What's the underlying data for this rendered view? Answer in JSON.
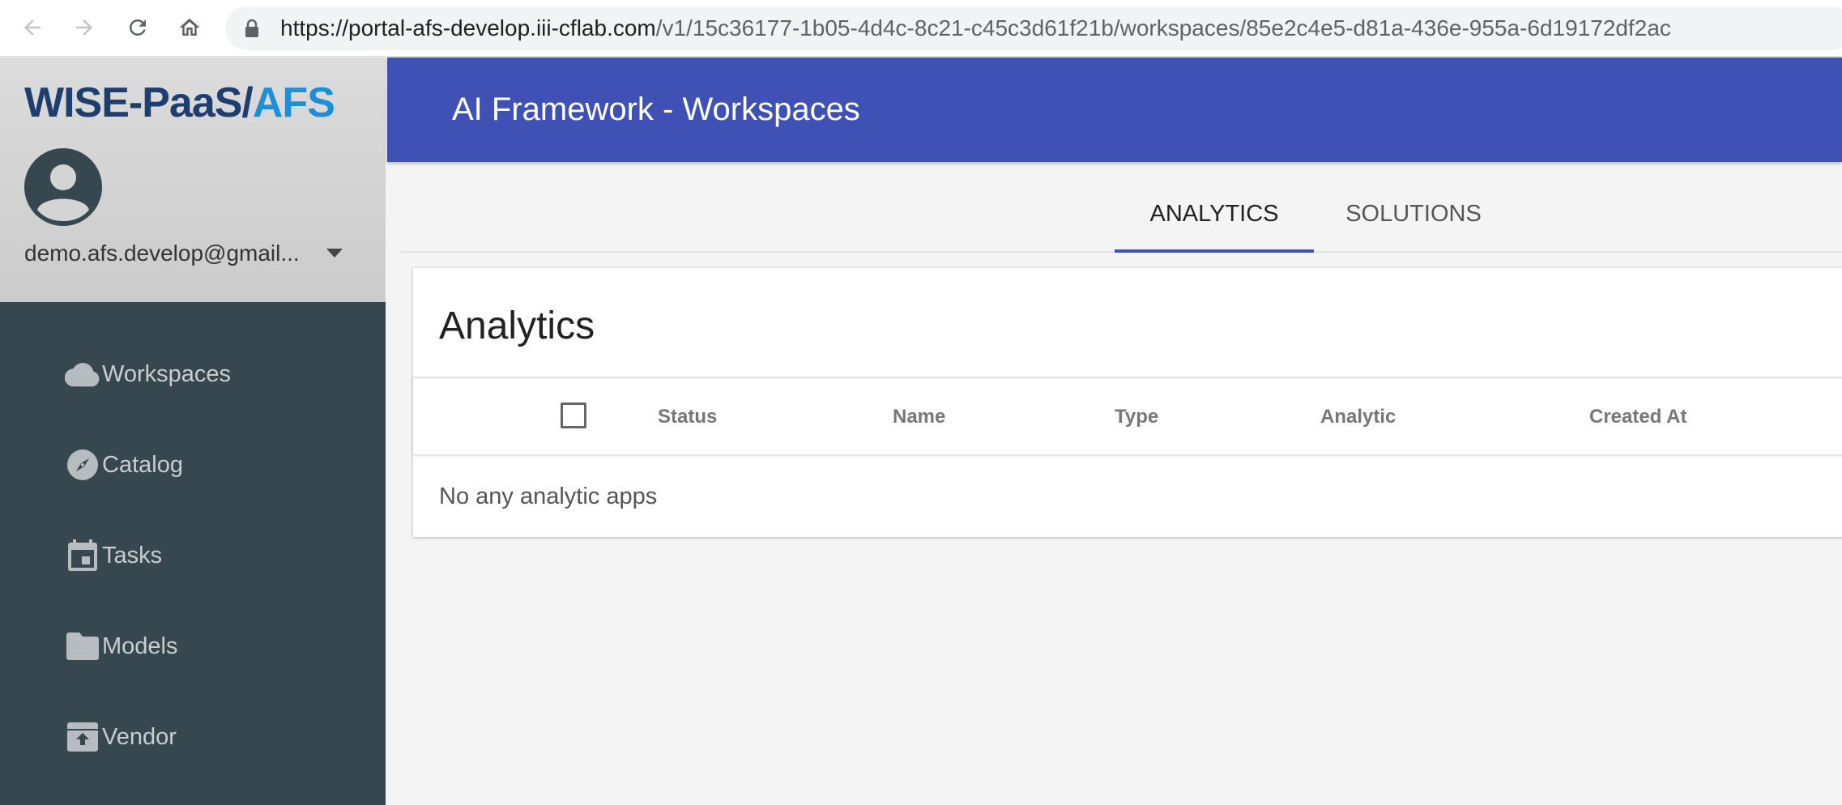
{
  "browser": {
    "url_host": "https://portal-afs-develop.iii-cflab.com",
    "url_path": "/v1/15c36177-1b05-4d4c-8c21-c45c3d61f21b/workspaces/85e2c4e5-d81a-436e-955a-6d19172df2ac"
  },
  "sidebar": {
    "logo_part1": "WISE-PaaS/",
    "logo_part2": "AFS",
    "user_email": "demo.afs.develop@gmail...",
    "items": [
      {
        "label": "Workspaces",
        "icon": "cloud-icon"
      },
      {
        "label": "Catalog",
        "icon": "compass-icon"
      },
      {
        "label": "Tasks",
        "icon": "calendar-icon"
      },
      {
        "label": "Models",
        "icon": "folder-icon"
      },
      {
        "label": "Vendor",
        "icon": "archive-upload-icon"
      }
    ]
  },
  "header": {
    "title": "AI Framework - Workspaces"
  },
  "tabs": [
    {
      "label": "ANALYTICS",
      "active": true
    },
    {
      "label": "SOLUTIONS",
      "active": false
    }
  ],
  "card": {
    "title": "Analytics",
    "columns": [
      "Status",
      "Name",
      "Type",
      "Analytic",
      "Created At"
    ],
    "empty_message": "No any analytic apps"
  },
  "colors": {
    "app_bar": "#3f51b5",
    "sidebar": "#37474f",
    "tab_indicator": "#3f51b5",
    "logo_dark": "#1d3e6e",
    "logo_accent": "#1d8fd6"
  }
}
